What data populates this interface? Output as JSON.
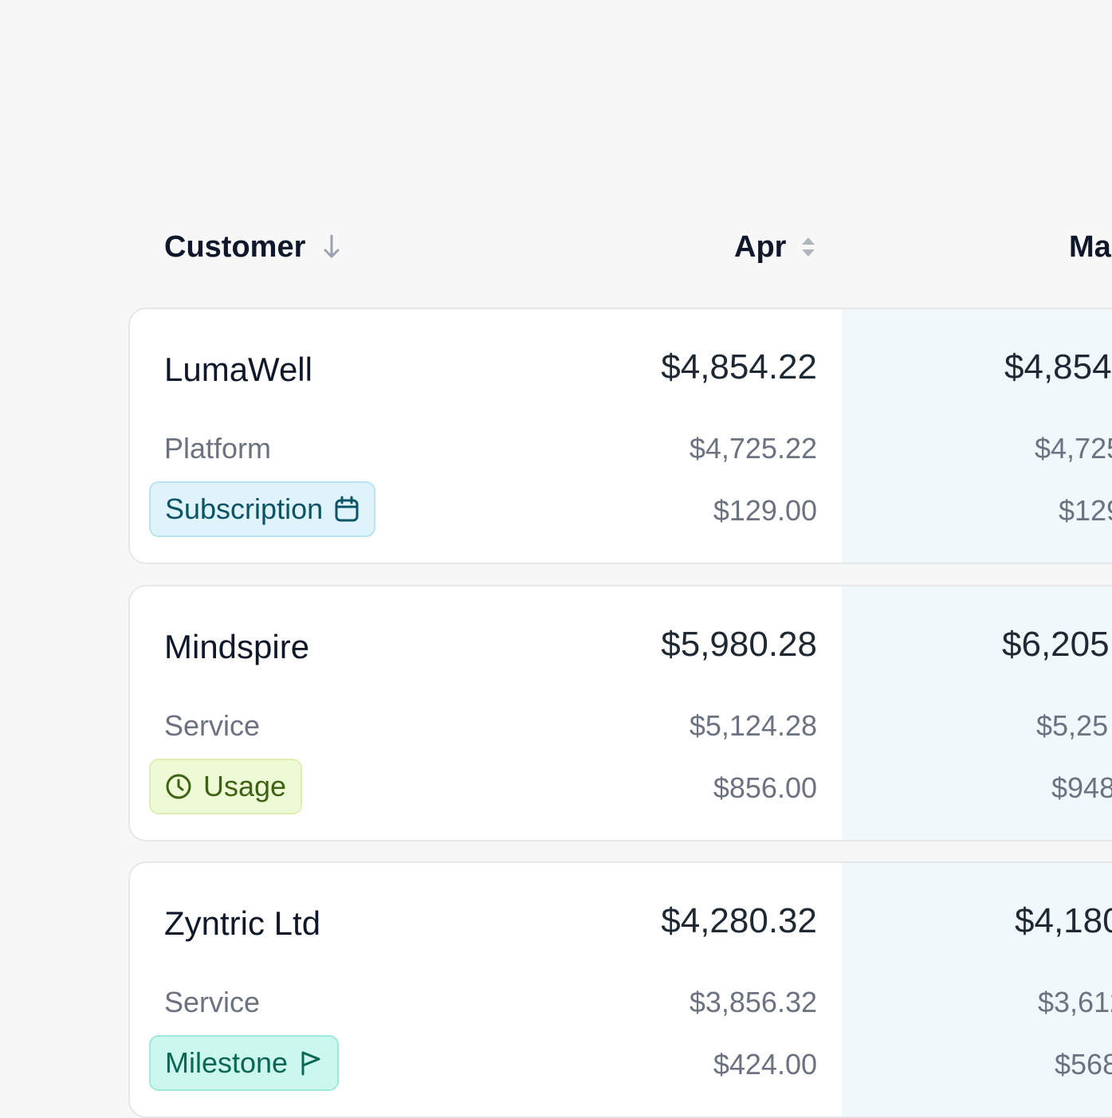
{
  "header": {
    "customer_label": "Customer",
    "apr_label": "Apr",
    "may_label": "Ma"
  },
  "rows": [
    {
      "customer": "LumaWell",
      "type": "Platform",
      "badge": "Subscription",
      "badge_icon": "calendar-icon",
      "apr": {
        "total": "$4,854.22",
        "line1": "$4,725.22",
        "line2": "$129.00"
      },
      "may": {
        "total": "$4,854",
        "line1": "$4,725",
        "line2": "$129"
      }
    },
    {
      "customer": "Mindspire",
      "type": "Service",
      "badge": "Usage",
      "badge_icon": "clock-icon",
      "apr": {
        "total": "$5,980.28",
        "line1": "$5,124.28",
        "line2": "$856.00"
      },
      "may": {
        "total": "$6,205",
        "line1": "$5,25",
        "line2": "$948"
      }
    },
    {
      "customer": "Zyntric Ltd",
      "type": "Service",
      "badge": "Milestone",
      "badge_icon": "flag-icon",
      "apr": {
        "total": "$4,280.32",
        "line1": "$3,856.32",
        "line2": "$424.00"
      },
      "may": {
        "total": "$4,180",
        "line1": "$3,612",
        "line2": "$568"
      }
    }
  ],
  "colors": {
    "page_bg": "#f7f7f7",
    "highlight_column": "#f0f8fc",
    "subscription_badge": "#dff3fb",
    "usage_badge": "#eefad6",
    "milestone_badge": "#cbf7ee"
  }
}
